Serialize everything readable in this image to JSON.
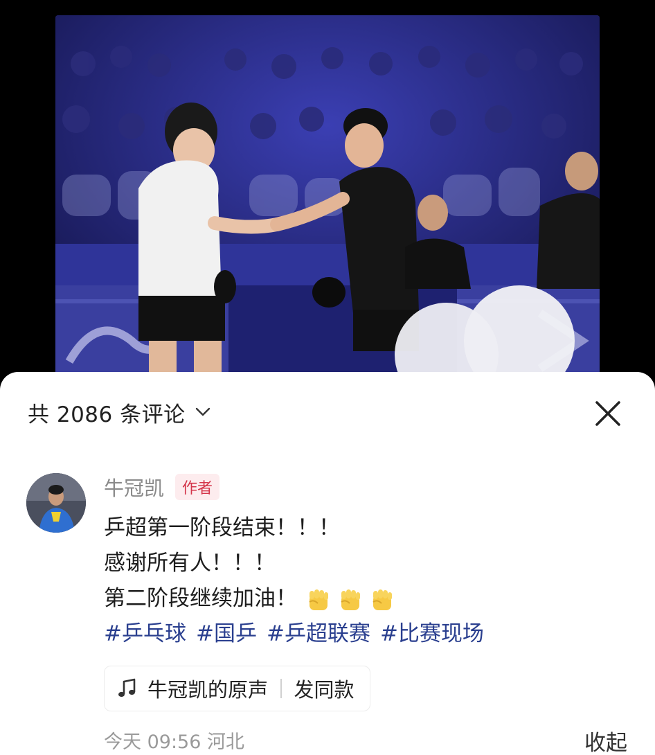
{
  "header": {
    "comment_count": "共 2086 条评论"
  },
  "comment": {
    "author": "牛冠凯",
    "badge": "作者",
    "lines": [
      "乒超第一阶段结束！！！",
      "感谢所有人！！！",
      "第二阶段继续加油！"
    ],
    "emojis": [
      "fist-icon",
      "fist-icon",
      "fist-icon"
    ],
    "tags": [
      "#乒乓球",
      "#国乒",
      "#乒超联赛",
      "#比赛现场"
    ],
    "sound": {
      "name": "牛冠凯的原声",
      "action": "发同款"
    },
    "time": "今天 09:56",
    "location": "河北",
    "collapse_label": "收起"
  },
  "colors": {
    "tag": "#2a3f8f",
    "badge_text": "#d4354a",
    "badge_bg": "#fdecee",
    "sheet_bg": "#ffffff",
    "screen_bg": "#000000"
  }
}
